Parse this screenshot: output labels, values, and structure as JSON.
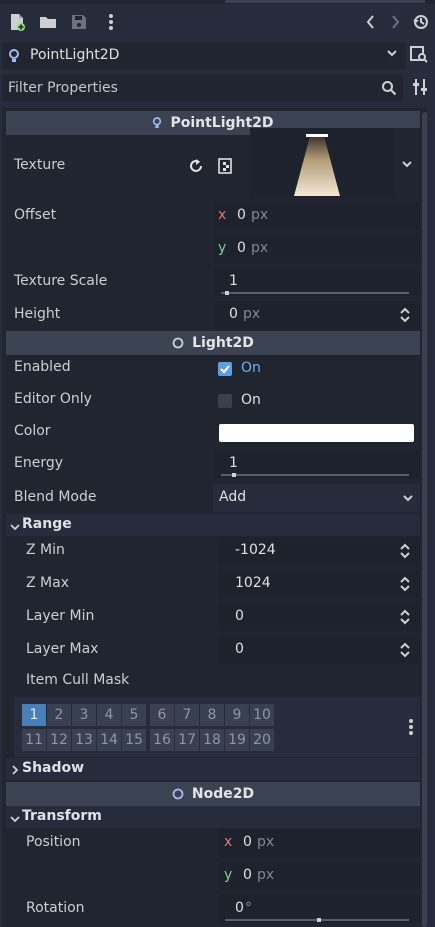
{
  "toolbar": {
    "icons": [
      "new-resource-icon",
      "open-folder-icon",
      "save-icon",
      "more-vertical-icon",
      "history-back-icon",
      "history-forward-icon",
      "object-history-icon"
    ]
  },
  "node_selector": {
    "label": "PointLight2D",
    "icon": "pointlight-icon"
  },
  "filter": {
    "placeholder": "Filter Properties"
  },
  "sections": {
    "pointlight": "PointLight2D",
    "light2d": "Light2D",
    "node2d": "Node2D"
  },
  "props": {
    "texture": {
      "label": "Texture"
    },
    "offset": {
      "label": "Offset",
      "x": "0",
      "y": "0",
      "unit": "px",
      "x_axis": "x",
      "y_axis": "y"
    },
    "texture_scale": {
      "label": "Texture Scale",
      "value": "1",
      "level": 0.02
    },
    "height": {
      "label": "Height",
      "value": "0",
      "unit": "px"
    },
    "enabled": {
      "label": "Enabled",
      "value": "On",
      "checked": true
    },
    "editor_only": {
      "label": "Editor Only",
      "value": "On",
      "checked": false
    },
    "color": {
      "label": "Color",
      "value": "#ffffff"
    },
    "energy": {
      "label": "Energy",
      "value": "1",
      "level": 0.06
    },
    "blend_mode": {
      "label": "Blend Mode",
      "value": "Add"
    }
  },
  "range": {
    "header": "Range",
    "z_min": {
      "label": "Z Min",
      "value": "-1024"
    },
    "z_max": {
      "label": "Z Max",
      "value": "1024"
    },
    "layer_min": {
      "label": "Layer Min",
      "value": "0"
    },
    "layer_max": {
      "label": "Layer Max",
      "value": "0"
    },
    "item_cull_mask": {
      "label": "Item Cull Mask",
      "bits": [
        "1",
        "2",
        "3",
        "4",
        "5",
        "6",
        "7",
        "8",
        "9",
        "10",
        "11",
        "12",
        "13",
        "14",
        "15",
        "16",
        "17",
        "18",
        "19",
        "20"
      ],
      "active": [
        "1"
      ]
    }
  },
  "shadow": {
    "header": "Shadow"
  },
  "transform": {
    "header": "Transform",
    "position": {
      "label": "Position",
      "x": "0",
      "y": "0",
      "unit": "px",
      "x_axis": "x",
      "y_axis": "y"
    },
    "rotation": {
      "label": "Rotation",
      "value": "0",
      "unit": "°",
      "level": 0.5
    }
  },
  "colors": {
    "accent": "#5d9ee6",
    "section_bg": "#3b4252",
    "panel_bg": "#20252f"
  }
}
